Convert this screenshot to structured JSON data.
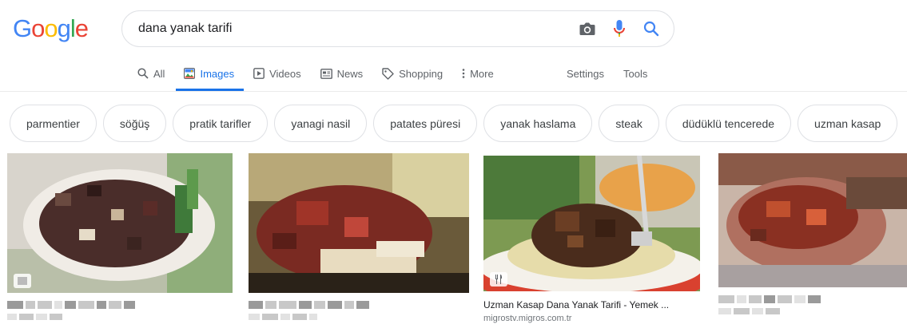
{
  "logo": {
    "letters": [
      "G",
      "o",
      "o",
      "g",
      "l",
      "e"
    ]
  },
  "search": {
    "query": "dana yanak tarifi"
  },
  "icons": {
    "camera": "camera-icon",
    "mic": "microphone-icon",
    "search": "search-icon"
  },
  "tabs": [
    {
      "label": "All",
      "icon": "search-icon"
    },
    {
      "label": "Images",
      "icon": "images-icon"
    },
    {
      "label": "Videos",
      "icon": "videos-icon"
    },
    {
      "label": "News",
      "icon": "news-icon"
    },
    {
      "label": "Shopping",
      "icon": "shopping-tag-icon"
    },
    {
      "label": "More",
      "icon": "more-dots-icon"
    }
  ],
  "settings_label": "Settings",
  "tools_label": "Tools",
  "chips": [
    "parmentier",
    "söğüş",
    "pratik tarifler",
    "yanagi nasil",
    "patates püresi",
    "yanak haslama",
    "steak",
    "düdüklü tencerede",
    "uzman kasap"
  ],
  "results": [
    {
      "title": "",
      "source": "",
      "blurred": true
    },
    {
      "title": "",
      "source": "",
      "blurred": true
    },
    {
      "title": "Uzman Kasap Dana Yanak Tarifi - Yemek ...",
      "source": "migrostv.migros.com.tr",
      "blurred": false,
      "badge": "recipe-icon"
    },
    {
      "title": "",
      "source": "",
      "blurred": true
    }
  ],
  "colors": {
    "accent": "#1a73e8",
    "google_blue": "#4285F4",
    "google_red": "#EA4335",
    "google_yellow": "#FBBC05",
    "google_green": "#34A853"
  }
}
